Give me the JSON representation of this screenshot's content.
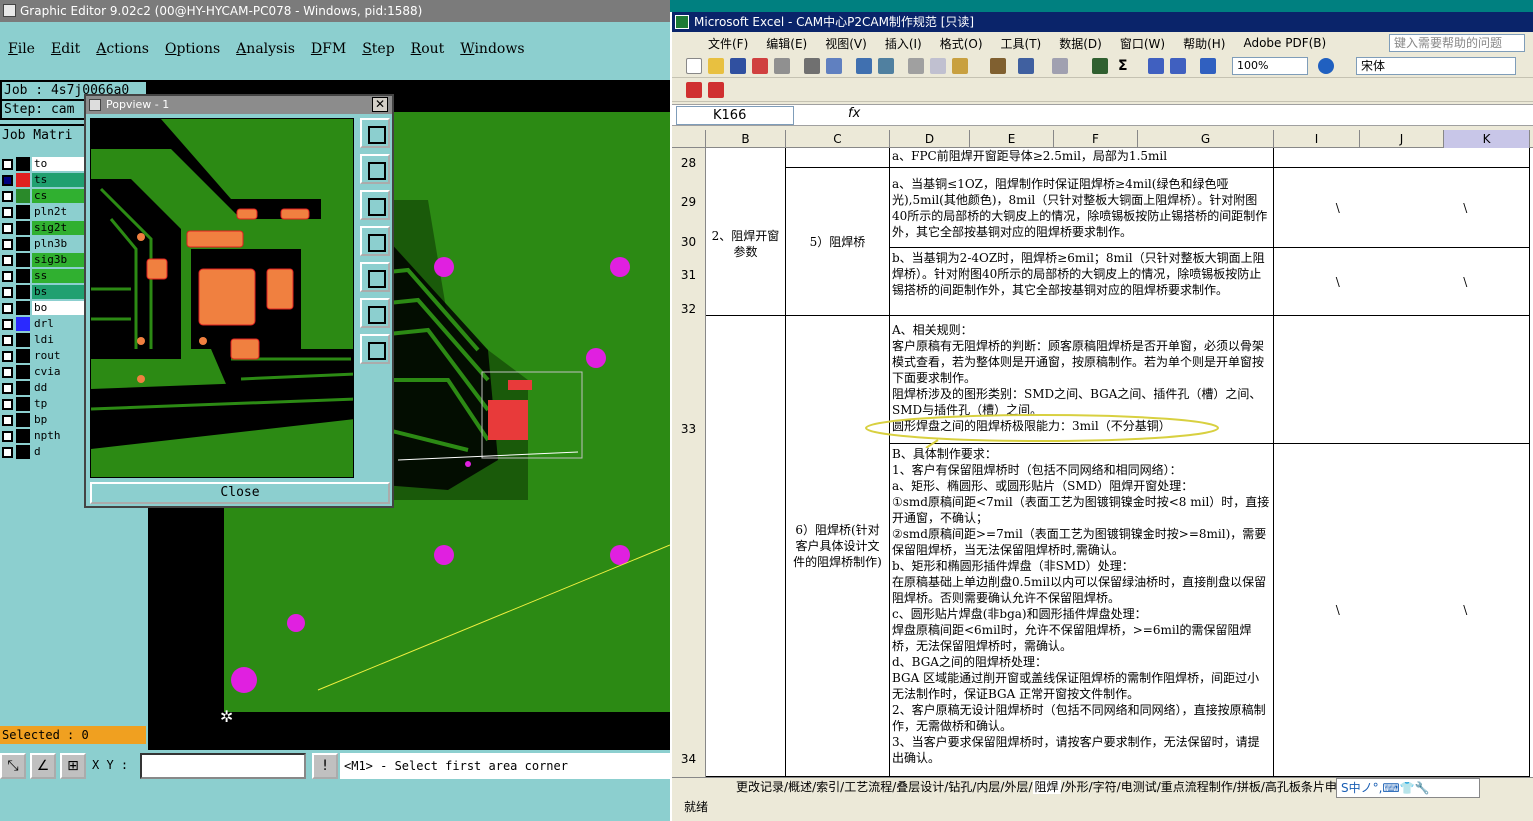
{
  "graphic_editor": {
    "title": "Graphic Editor 9.02c2 (00@HY-HYCAM-PC078 - Windows, pid:1588)",
    "menu": [
      "File",
      "Edit",
      "Actions",
      "Options",
      "Analysis",
      "DFM",
      "Step",
      "Rout",
      "Windows"
    ],
    "job_line": "Job : 4s7j0066a0",
    "step_line": "Step: cam",
    "job_matrix_label": "Job Matri",
    "layers": [
      {
        "name": "to",
        "color": "#ffffff",
        "swatch": "#000000",
        "checked": false
      },
      {
        "name": "ts",
        "color": "#20a070",
        "swatch": "#e02020",
        "checked": true
      },
      {
        "name": "cs",
        "color": "#30b030",
        "swatch": "#2a8a2a",
        "checked": false
      },
      {
        "name": "pln2t",
        "color": "#8ccfcf",
        "swatch": "#000000",
        "checked": false
      },
      {
        "name": "sig2t",
        "color": "#30b030",
        "swatch": "#000000",
        "checked": false
      },
      {
        "name": "pln3b",
        "color": "#8ccfcf",
        "swatch": "#000000",
        "checked": false
      },
      {
        "name": "sig3b",
        "color": "#30b030",
        "swatch": "#000000",
        "checked": false
      },
      {
        "name": "ss",
        "color": "#30b030",
        "swatch": "#000000",
        "checked": false
      },
      {
        "name": "bs",
        "color": "#20a070",
        "swatch": "#000000",
        "checked": false
      },
      {
        "name": "bo",
        "color": "#ffffff",
        "swatch": "#000000",
        "checked": false
      },
      {
        "name": "drl",
        "color": "#8ccfcf",
        "swatch": "#2a2aff",
        "checked": false
      },
      {
        "name": "ldi",
        "color": "#8ccfcf",
        "swatch": "#000000",
        "checked": false
      },
      {
        "name": "rout",
        "color": "#8ccfcf",
        "swatch": "#000000",
        "checked": false
      },
      {
        "name": "cvia",
        "color": "#8ccfcf",
        "swatch": "#000000",
        "checked": false
      },
      {
        "name": "dd",
        "color": "#8ccfcf",
        "swatch": "#000000",
        "checked": false
      },
      {
        "name": "tp",
        "color": "#8ccfcf",
        "swatch": "#000000",
        "checked": false
      },
      {
        "name": "bp",
        "color": "#8ccfcf",
        "swatch": "#000000",
        "checked": false
      },
      {
        "name": "npth",
        "color": "#8ccfcf",
        "swatch": "#000000",
        "checked": false
      },
      {
        "name": "d",
        "color": "#8ccfcf",
        "swatch": "#000000",
        "checked": false
      }
    ],
    "selected": "Selected : 0",
    "xy_label": "X Y :",
    "xy_value": "",
    "prompt_mark": "!",
    "prompt": "<M1> - Select first area corner",
    "popview": {
      "title": "Popview - 1",
      "close_x": "✕",
      "close_label": "Close"
    }
  },
  "excel": {
    "title": "Microsoft Excel - CAM中心P2CAM制作规范 [只读]",
    "menu": [
      "文件(F)",
      "编辑(E)",
      "视图(V)",
      "插入(I)",
      "格式(O)",
      "工具(T)",
      "数据(D)",
      "窗口(W)",
      "帮助(H)",
      "Adobe PDF(B)"
    ],
    "help_placeholder": "键入需要帮助的问题",
    "zoom": "100%",
    "font": "宋体",
    "name_box": "K166",
    "fx": "fx",
    "columns": [
      "B",
      "C",
      "D",
      "E",
      "F",
      "G",
      "I",
      "J",
      "K"
    ],
    "rows": [
      "28",
      "29",
      "30",
      "31",
      "32",
      "33",
      "34"
    ],
    "cells": {
      "r28_d": "a、FPC前阻焊开窗距导体≥2.5mil，局部为1.5mil",
      "b_group": "2、阻焊开窗参数",
      "c5": "5）阻焊桥",
      "c6": "6）阻焊桥(针对客户具体设计文件的阻焊桥制作)",
      "d29": "a、当基铜≤1OZ，阻焊制作时保证阻焊桥≥4mil(绿色和绿色哑光),5mil(其他颜色)，8mil（只针对整板大铜面上阻焊桥）。针对附图40所示的局部桥的大铜皮上的情况，除喷锡板按防止锡搭桥的间距制作外，其它全部按基铜对应的阻焊桥要求制作。",
      "d31": "b、当基铜为2-4OZ时，阻焊桥≥6mil；8mil（只针对整板大铜面上阻焊桥）。针对附图40所示的局部桥的大铜皮上的情况，除喷锡板按防止锡搭桥的间距制作外，其它全部按基铜对应的阻焊桥要求制作。",
      "d33a": "A、相关规则：",
      "d33b": "客户原稿有无阻焊桥的判断：顾客原稿阻焊桥是否开单窗，必须以骨架模式查看，若为整体则是开通窗，按原稿制作。若为单个则是开单窗按下面要求制作。",
      "d33c": "阻焊桥涉及的图形类别：SMD之间、BGA之间、插件孔（槽）之间、SMD与插件孔（槽）之间。",
      "d33d": "圆形焊盘之间的阻焊桥极限能力：3mil（不分基铜）",
      "d34": "B、具体制作要求：\n1、客户有保留阻焊桥时（包括不同网络和相同网络）：\na、矩形、椭圆形、或圆形贴片（SMD）阻焊开窗处理：\n①smd原稿间距<7mil（表面工艺为图镀铜镍金时按<8 mil）时，直接开通窗，不确认；\n②smd原稿间距>=7mil（表面工艺为图镀铜镍金时按>=8mil)，需要保留阻焊桥，当无法保留阻焊桥时,需确认。\nb、矩形和椭圆形插件焊盘（非SMD）处理：\n在原稿基础上单边削盘0.5mil以内可以保留绿油桥时，直接削盘以保留阻焊桥。否则需要确认允许不保留阻焊桥。\nc、圆形贴片焊盘(非bga)和圆形插件焊盘处理：\n焊盘原稿间距<6mil时，允许不保留阻焊桥，>=6mil的需保留阻焊桥，无法保留阻焊桥时，需确认。\nd、BGA之间的阻焊桥处理：\nBGA 区域能通过削开窗或盖线保证阻焊桥的需制作阻焊桥，间距过小无法制作时，保证BGA 正常开窗按文件制作。\n2、客户原稿无设计阻焊桥时（包括不同网络和同网络），直接按原稿制作，无需做桥和确认。\n3、当客户要求保留阻焊桥时，请按客户要求制作，无法保留时，请提出确认。",
      "slash": "\\"
    },
    "tabs": [
      "更改记录",
      "概述",
      "索引",
      "工艺流程",
      "叠层设计",
      "钻孔",
      "内层",
      "外层",
      "阻焊",
      "外形",
      "字符",
      "电测试",
      "重点流程制作",
      "拼板",
      "高孔板条片申制"
    ],
    "active_tab": "阻焊",
    "status": "就绪",
    "ime": "S中ノ°,⌨👕🔧"
  }
}
